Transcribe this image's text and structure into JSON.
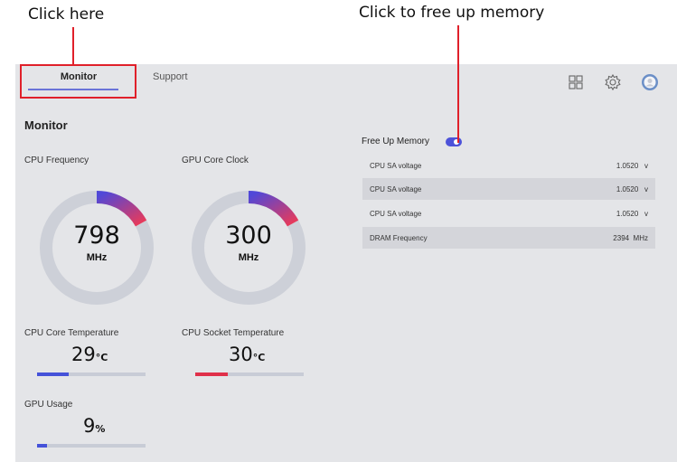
{
  "callouts": {
    "left": "Click here",
    "right": "Click to free up memory"
  },
  "tabs": {
    "monitor": "Monitor",
    "support": "Support"
  },
  "toolbar_icons": [
    "grid-icon",
    "gear-icon",
    "user-avatar-icon"
  ],
  "section_title": "Monitor",
  "gauges": [
    {
      "label": "CPU Frequency",
      "value": "798",
      "unit": "MHz",
      "fraction": 0.17
    },
    {
      "label": "GPU Core Clock",
      "value": "300",
      "unit": "MHz",
      "fraction": 0.17
    }
  ],
  "temperatures": [
    {
      "label": "CPU Core Temperature",
      "value": "29",
      "unit": "°C",
      "fraction": 0.29,
      "color": "#4552d9"
    },
    {
      "label": "CPU Socket Temperature",
      "value": "30",
      "unit": "°C",
      "fraction": 0.3,
      "color": "#e0304a"
    },
    {
      "label": "GPU Usage",
      "value": "9",
      "unit": "%",
      "fraction": 0.09,
      "color": "#4552d9"
    }
  ],
  "free_memory": {
    "label": "Free Up Memory",
    "enabled": true
  },
  "voltages": [
    {
      "name": "CPU SA voltage",
      "value": "1.0520",
      "unit": "v"
    },
    {
      "name": "CPU SA voltage",
      "value": "1.0520",
      "unit": "v"
    },
    {
      "name": "CPU SA voltage",
      "value": "1.0520",
      "unit": "v"
    },
    {
      "name": "DRAM Frequency",
      "value": "2394",
      "unit": "MHz"
    }
  ],
  "colors": {
    "accent": "#4d52d9",
    "callout": "#e0202a",
    "gauge_track": "#cdd0d8"
  }
}
